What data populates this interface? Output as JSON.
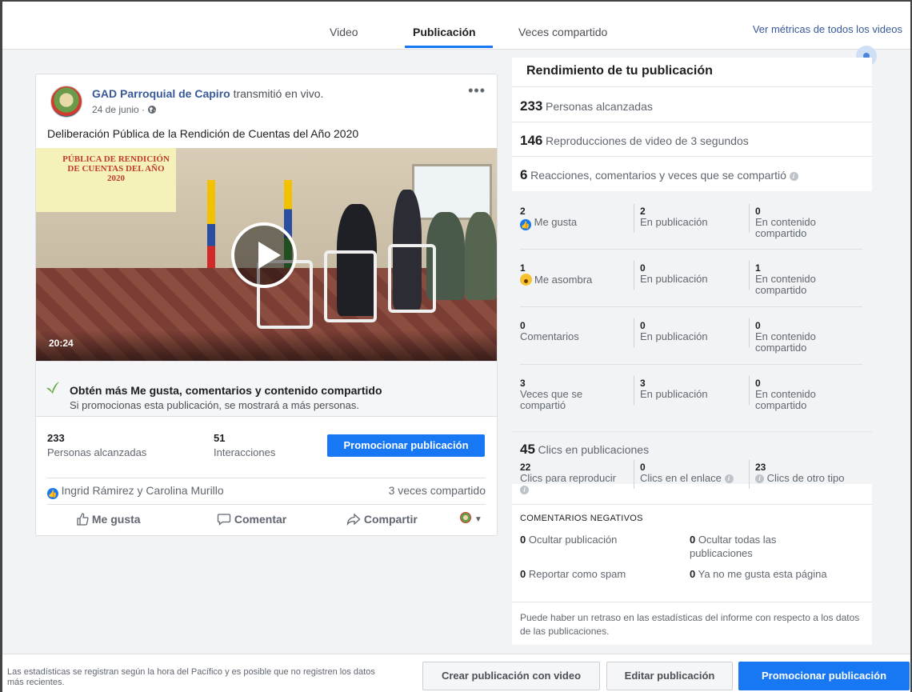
{
  "tabs": {
    "video": "Video",
    "publicacion": "Publicación",
    "veces_compartido": "Veces compartido"
  },
  "top_link": "Ver métricas de todos los videos",
  "post": {
    "page_name": "GAD Parroquial de Capiro",
    "action_text": "transmitió en vivo.",
    "date": "24 de junio ·",
    "text": "Deliberación Pública de la Rendición de Cuentas del Año 2020",
    "video_screen_text": "PÚBLICA DE RENDICIÓN DE CUENTAS DEL AÑO 2020",
    "video_duration": "20:24",
    "promo_title": "Obtén más Me gusta, comentarios y contenido compartido",
    "promo_sub": "Si promocionas esta publicación, se mostrará a más personas.",
    "reach_num": "233",
    "reach_label": "Personas alcanzadas",
    "interactions_num": "51",
    "interactions_label": "Interacciones",
    "promote_button": "Promocionar publicación",
    "reactors": "Ingrid Rámirez y Carolina Murillo",
    "shares": "3 veces compartido",
    "like_action": "Me gusta",
    "comment_action": "Comentar",
    "share_action": "Compartir"
  },
  "panel": {
    "title": "Rendimiento de tu publicación",
    "reached_num": "233",
    "reached_label": "Personas alcanzadas",
    "plays_num": "146",
    "plays_label": "Reproducciones de video de 3 segundos",
    "engagement_num": "6",
    "engagement_label": "Reacciones, comentarios y veces que se compartió",
    "grid": {
      "likes": {
        "total": "2",
        "label": "Me gusta",
        "post": "2",
        "shared": "0"
      },
      "wow": {
        "total": "1",
        "label": "Me asombra",
        "post": "0",
        "shared": "1"
      },
      "comments": {
        "total": "0",
        "label": "Comentarios",
        "post": "0",
        "shared": "0"
      },
      "shares": {
        "total": "3",
        "label": "Veces que se compartió",
        "post": "3",
        "shared": "0"
      },
      "on_post_label": "En publicación",
      "on_shared_label": "En contenido compartido"
    },
    "clicks_num": "45",
    "clicks_label": "Clics en publicaciones",
    "clicks_play_num": "22",
    "clicks_play_label": "Clics para reproducir",
    "clicks_link_num": "0",
    "clicks_link_label": "Clics en el enlace",
    "clicks_other_num": "23",
    "clicks_other_label": "Clics de otro tipo",
    "negative_title": "COMENTARIOS NEGATIVOS",
    "hide_post_num": "0",
    "hide_post_label": "Ocultar publicación",
    "hide_all_num": "0",
    "hide_all_label": "Ocultar todas las publicaciones",
    "spam_num": "0",
    "spam_label": "Reportar como spam",
    "unlike_num": "0",
    "unlike_label": "Ya no me gusta esta página",
    "footnote": "Puede haber un retraso en las estadísticas del informe con respecto a los datos de las publicaciones."
  },
  "bottom": {
    "note": "Las estadísticas se registran según la hora del Pacífico y es posible que no registren los datos más recientes.",
    "create_video_post": "Crear publicación con video",
    "edit_post": "Editar publicación",
    "promote_post": "Promocionar publicación"
  },
  "colors": {
    "accent": "#1877f2",
    "link": "#385898",
    "bg": "#f2f3f5"
  }
}
